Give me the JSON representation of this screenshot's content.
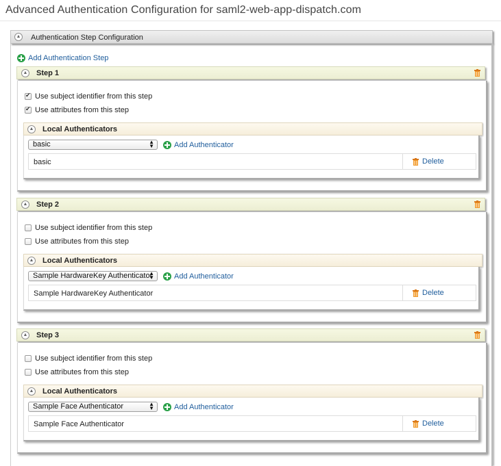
{
  "page": {
    "title": "Advanced Authentication Configuration for saml2-web-app-dispatch.com"
  },
  "section": {
    "title": "Authentication Step Configuration",
    "add_step_label": "Add Authentication Step"
  },
  "labels": {
    "use_subject": "Use subject identifier from this step",
    "use_attributes": "Use attributes from this step",
    "local_authenticators": "Local Authenticators",
    "add_authenticator": "Add Authenticator",
    "delete": "Delete"
  },
  "steps": [
    {
      "title": "Step 1",
      "use_subject_checked": true,
      "use_attributes_checked": true,
      "selected_authenticator": "basic",
      "authenticators": [
        "basic"
      ]
    },
    {
      "title": "Step 2",
      "use_subject_checked": false,
      "use_attributes_checked": false,
      "selected_authenticator": "Sample HardwareKey Authenticator",
      "authenticators": [
        "Sample HardwareKey Authenticator"
      ]
    },
    {
      "title": "Step 3",
      "use_subject_checked": false,
      "use_attributes_checked": false,
      "selected_authenticator": "Sample Face Authenticator",
      "authenticators": [
        "Sample Face Authenticator"
      ]
    }
  ],
  "colors": {
    "link": "#1f5d9c",
    "add_icon": "#2aa048",
    "trash_icon": "#e8901a"
  },
  "icons": {
    "collapse": "chevron-up-icon",
    "add": "plus-circle-icon",
    "delete": "trash-icon",
    "select": "select-arrows-icon"
  }
}
